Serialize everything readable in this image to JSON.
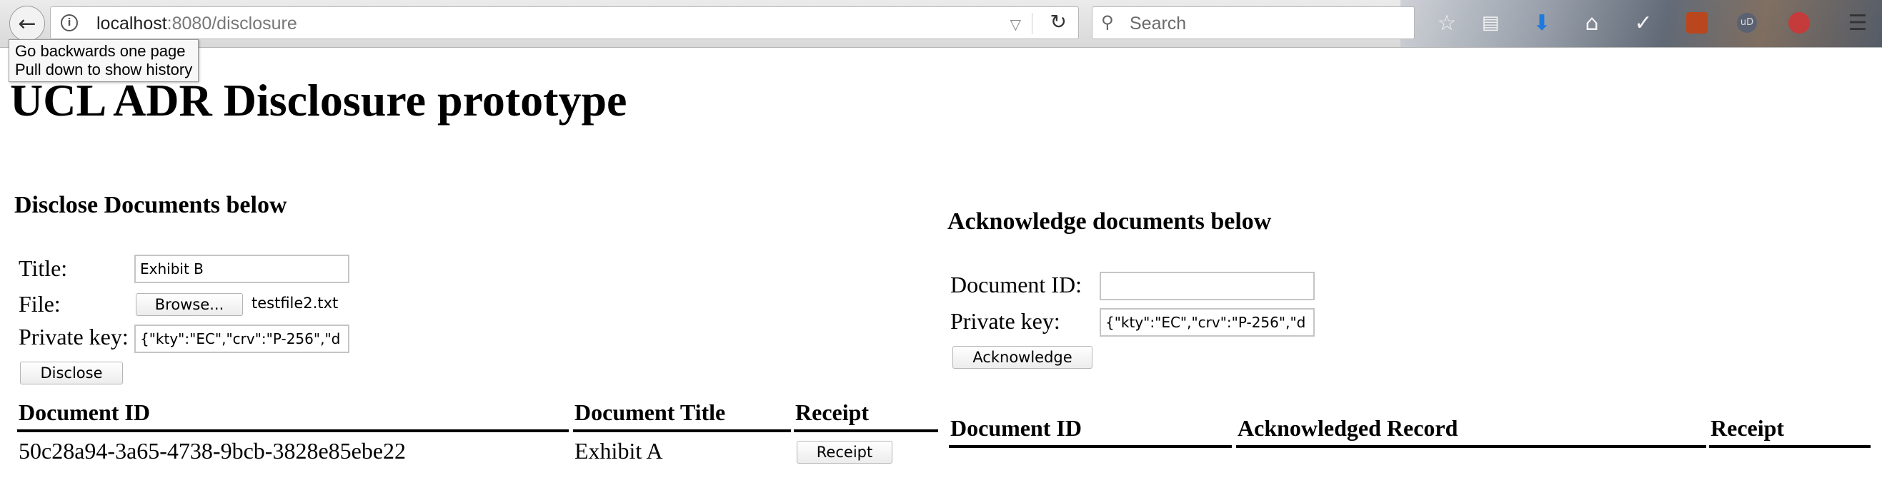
{
  "browser": {
    "url_host": "localhost",
    "url_path": ":8080/disclosure",
    "search_placeholder": "Search",
    "tooltip_line1": "Go backwards one page",
    "tooltip_line2": "Pull down to show history"
  },
  "page": {
    "title": "UCL ADR Disclosure prototype"
  },
  "disclose": {
    "heading": "Disclose Documents below",
    "title_label": "Title:",
    "title_value": "Exhibit B",
    "file_label": "File:",
    "browse_label": "Browse...",
    "file_name": "testfile2.txt",
    "key_label": "Private key:",
    "key_value": "{\"kty\":\"EC\",\"crv\":\"P-256\",\"d",
    "disclose_button": "Disclose",
    "table": {
      "headers": [
        "Document ID",
        "Document Title",
        "Receipt"
      ],
      "rows": [
        {
          "id": "50c28a94-3a65-4738-9bcb-3828e85ebe22",
          "title": "Exhibit A",
          "receipt_button": "Receipt"
        }
      ]
    }
  },
  "acknowledge": {
    "heading": "Acknowledge documents below",
    "docid_label": "Document ID:",
    "docid_value": "",
    "key_label": "Private key:",
    "key_value": "{\"kty\":\"EC\",\"crv\":\"P-256\",\"d",
    "acknowledge_button": "Acknowledge",
    "table": {
      "headers": [
        "Document ID",
        "Acknowledged Record",
        "Receipt"
      ]
    }
  }
}
